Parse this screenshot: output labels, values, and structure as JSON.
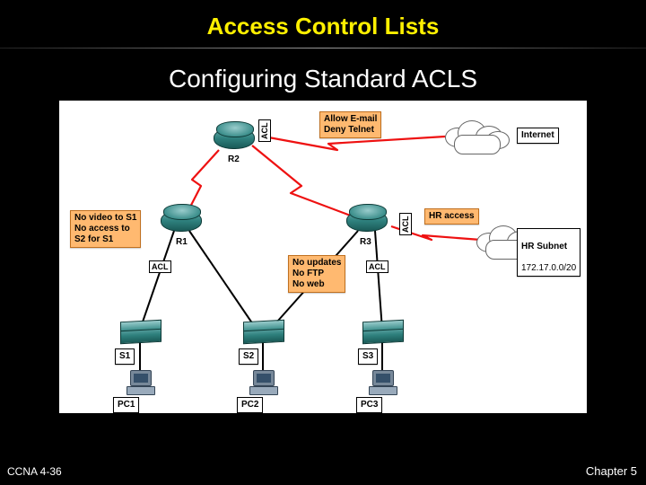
{
  "header": {
    "title": "Access Control Lists"
  },
  "subtitle": "Configuring Standard ACLS",
  "footer": {
    "left": "CCNA 4-36",
    "right": "Chapter 5"
  },
  "diagram": {
    "devices": {
      "r1": "R1",
      "r2": "R2",
      "r3": "R3",
      "s1": "S1",
      "s2": "S2",
      "s3": "S3",
      "pc1": "PC1",
      "pc2": "PC2",
      "pc3": "PC3"
    },
    "clouds": {
      "internet": "Internet",
      "hr_subnet": {
        "title": "HR Subnet",
        "addr": "172.17.0.0/20"
      }
    },
    "notes": {
      "r2_policy": "Allow E-mail\nDeny Telnet",
      "r1_policy": "No video to S1\nNo access to\nS2 for S1",
      "r3_policy": "No updates\nNo FTP\nNo web",
      "hr_access": "HR access"
    },
    "acl_label": "ACL"
  }
}
